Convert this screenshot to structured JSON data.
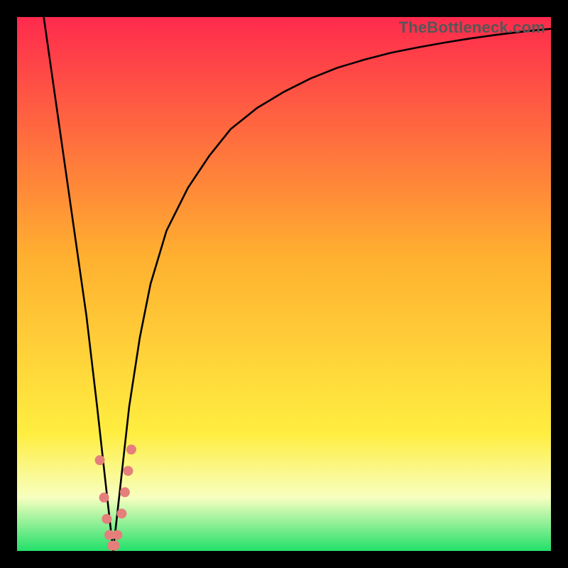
{
  "watermark": "TheBottleneck.com",
  "colors": {
    "bg_black": "#000000",
    "gradient_top": "#ff2a4d",
    "gradient_mid": "#ffb030",
    "gradient_low": "#ffee40",
    "gradient_pale": "#f7ffc0",
    "gradient_green": "#22e06a",
    "curve": "#000000",
    "dot": "#e57f7b"
  },
  "chart_data": {
    "type": "line",
    "title": "",
    "xlabel": "",
    "ylabel": "",
    "xlim": [
      0,
      100
    ],
    "ylim": [
      0,
      100
    ],
    "minimum_x": 18,
    "series": [
      {
        "name": "bottleneck-curve",
        "x": [
          5,
          7,
          9,
          11,
          13,
          15,
          16,
          17,
          18,
          19,
          20,
          21,
          23,
          25,
          28,
          32,
          36,
          40,
          45,
          50,
          55,
          60,
          65,
          70,
          75,
          80,
          85,
          90,
          95,
          100
        ],
        "y": [
          100,
          86,
          72,
          58,
          44,
          27,
          18,
          9,
          0,
          9,
          18,
          27,
          40,
          50,
          60,
          68,
          74,
          79,
          83,
          86,
          88.5,
          90.5,
          92,
          93.3,
          94.3,
          95.2,
          96,
          96.7,
          97.3,
          97.8
        ]
      }
    ],
    "dots": [
      {
        "x": 15.5,
        "y": 17
      },
      {
        "x": 16.3,
        "y": 10
      },
      {
        "x": 16.8,
        "y": 6
      },
      {
        "x": 17.3,
        "y": 3
      },
      {
        "x": 17.8,
        "y": 1
      },
      {
        "x": 18.3,
        "y": 1
      },
      {
        "x": 18.8,
        "y": 3
      },
      {
        "x": 19.6,
        "y": 7
      },
      {
        "x": 20.2,
        "y": 11
      },
      {
        "x": 20.8,
        "y": 15
      },
      {
        "x": 21.4,
        "y": 19
      }
    ]
  }
}
